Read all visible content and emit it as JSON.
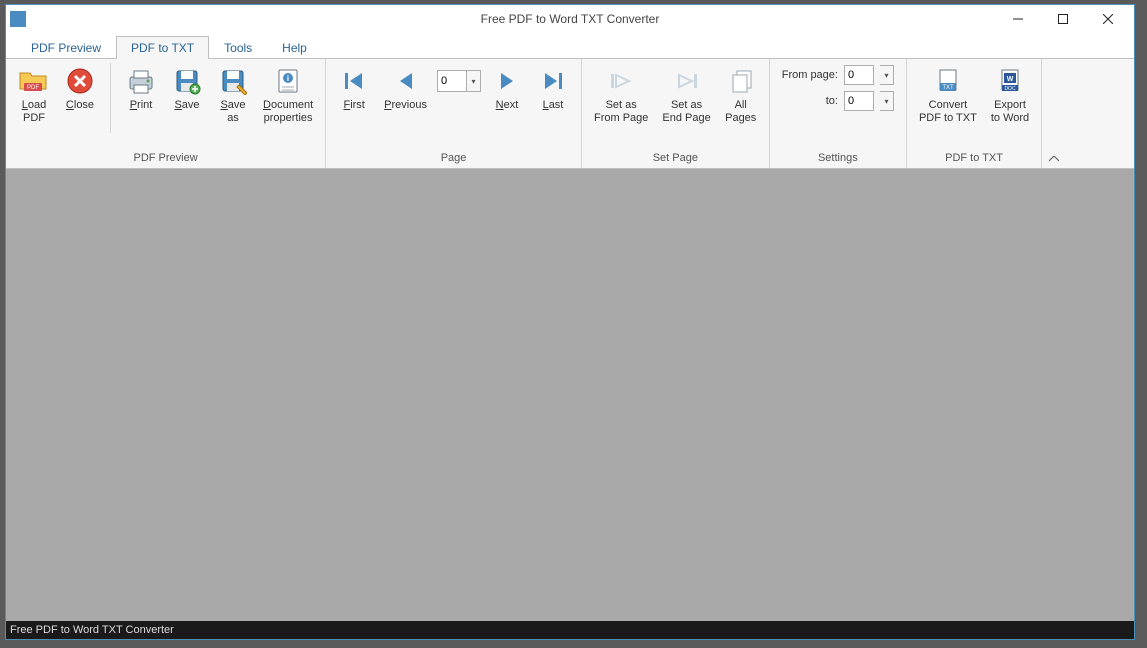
{
  "window": {
    "title": "Free PDF to Word TXT Converter",
    "status": "Free PDF to Word TXT Converter"
  },
  "tabs": {
    "items": [
      "PDF Preview",
      "PDF to TXT",
      "Tools",
      "Help"
    ],
    "active": 1
  },
  "ribbon": {
    "groups": {
      "preview": {
        "title": "PDF Preview",
        "load": "Load\nPDF",
        "close": "Close",
        "print": "Print",
        "save": "Save",
        "saveas": "Save\nas",
        "docprops": "Document\nproperties"
      },
      "page": {
        "title": "Page",
        "first": "First",
        "previous": "Previous",
        "current": "0",
        "next": "Next",
        "last": "Last"
      },
      "setpage": {
        "title": "Set Page",
        "setfrom": "Set as\nFrom Page",
        "setend": "Set as\nEnd Page",
        "allpages": "All\nPages"
      },
      "settings": {
        "title": "Settings",
        "fromlabel": "From page:",
        "from": "0",
        "tolabel": "to:",
        "to": "0"
      },
      "convert": {
        "title": "PDF to TXT",
        "totxt": "Convert\nPDF to TXT",
        "toword": "Export\nto Word"
      }
    }
  }
}
